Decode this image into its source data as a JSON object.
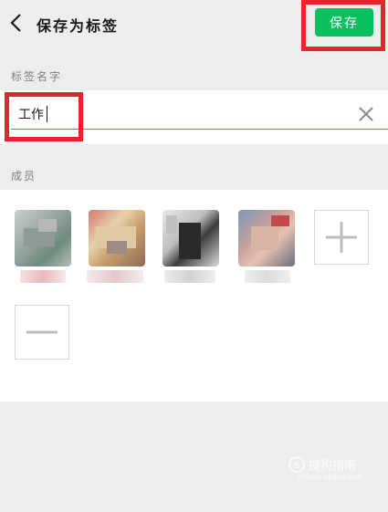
{
  "header": {
    "title": "保存为标签",
    "save_label": "保存"
  },
  "name_section": {
    "label": "标签名字",
    "input_value": "工作"
  },
  "members_section": {
    "label": "成员",
    "members": [
      {
        "name": "member-1"
      },
      {
        "name": "member-2"
      },
      {
        "name": "member-3"
      },
      {
        "name": "member-4"
      }
    ]
  },
  "watermark": {
    "brand": "搜狗指南",
    "url": "zhinan.sogou.com"
  },
  "colors": {
    "accent": "#07c160",
    "highlight": "#e5242b",
    "background": "#ededed"
  }
}
